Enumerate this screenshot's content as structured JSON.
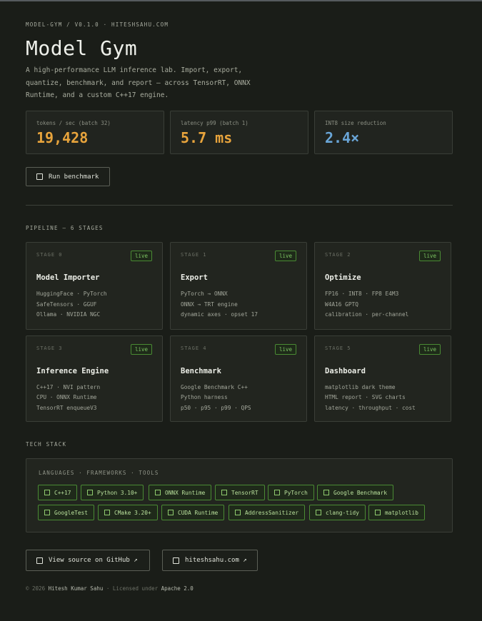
{
  "header": {
    "kicker": "MODEL-GYM / V0.1.0 · HITESHSAHU.COM",
    "title": "Model Gym",
    "description": "A high-performance LLM inference lab. Import, export, quantize, benchmark, and report — across TensorRT, ONNX Runtime, and a custom C++17 engine."
  },
  "stats": [
    {
      "label": "tokens / sec (batch 32)",
      "value": "19,428",
      "color": "#e8a43c"
    },
    {
      "label": "latency p99 (batch 1)",
      "value": "5.7 ms",
      "color": "#e8a43c"
    },
    {
      "label": "INT8 size reduction",
      "value": "2.4×",
      "color": "#6aa6d8"
    }
  ],
  "run_button": {
    "label": "Run benchmark"
  },
  "pipeline": {
    "label": "PIPELINE — 6 STAGES",
    "stages": [
      {
        "stage": "STAGE 0",
        "status": "live",
        "name": "Model Importer",
        "lines": [
          "HuggingFace · PyTorch",
          "SafeTensors · GGUF",
          "Ollama · NVIDIA NGC"
        ]
      },
      {
        "stage": "STAGE 1",
        "status": "live",
        "name": "Export",
        "lines": [
          "PyTorch → ONNX",
          "ONNX → TRT engine",
          "dynamic axes · opset 17"
        ]
      },
      {
        "stage": "STAGE 2",
        "status": "live",
        "name": "Optimize",
        "lines": [
          "FP16 · INT8 · FP8 E4M3",
          "W4A16 GPTQ",
          "calibration · per-channel"
        ]
      },
      {
        "stage": "STAGE 3",
        "status": "live",
        "name": "Inference Engine",
        "lines": [
          "C++17 · NVI pattern",
          "CPU · ONNX Runtime",
          "TensorRT enqueueV3"
        ]
      },
      {
        "stage": "STAGE 4",
        "status": "live",
        "name": "Benchmark",
        "lines": [
          "Google Benchmark C++",
          "Python harness",
          "p50 · p95 · p99 · QPS"
        ]
      },
      {
        "stage": "STAGE 5",
        "status": "live",
        "name": "Dashboard",
        "lines": [
          "matplotlib dark theme",
          "HTML report · SVG charts",
          "latency · throughput · cost"
        ]
      }
    ]
  },
  "tech_stack": {
    "label": "TECH STACK",
    "sublabel": "LANGUAGES · FRAMEWORKS · TOOLS",
    "chips": [
      "C++17",
      "Python 3.10+",
      "ONNX Runtime",
      "TensorRT",
      "PyTorch",
      "Google Benchmark",
      "GoogleTest",
      "CMake 3.20+",
      "CUDA Runtime",
      "AddressSanitizer",
      "clang-tidy",
      "matplotlib"
    ]
  },
  "links": {
    "github": "View source on GitHub ↗",
    "site": "hiteshsahu.com ↗"
  },
  "footer": {
    "copyright": "© 2026",
    "author": "Hitesh Kumar Sahu",
    "licensed": "· Licensed under",
    "license": "Apache 2.0"
  },
  "colors": {
    "accent_amber": "#e8a43c",
    "accent_blue": "#6aa6d8",
    "live_green": "#7cc462",
    "background": "#1a1d18"
  }
}
